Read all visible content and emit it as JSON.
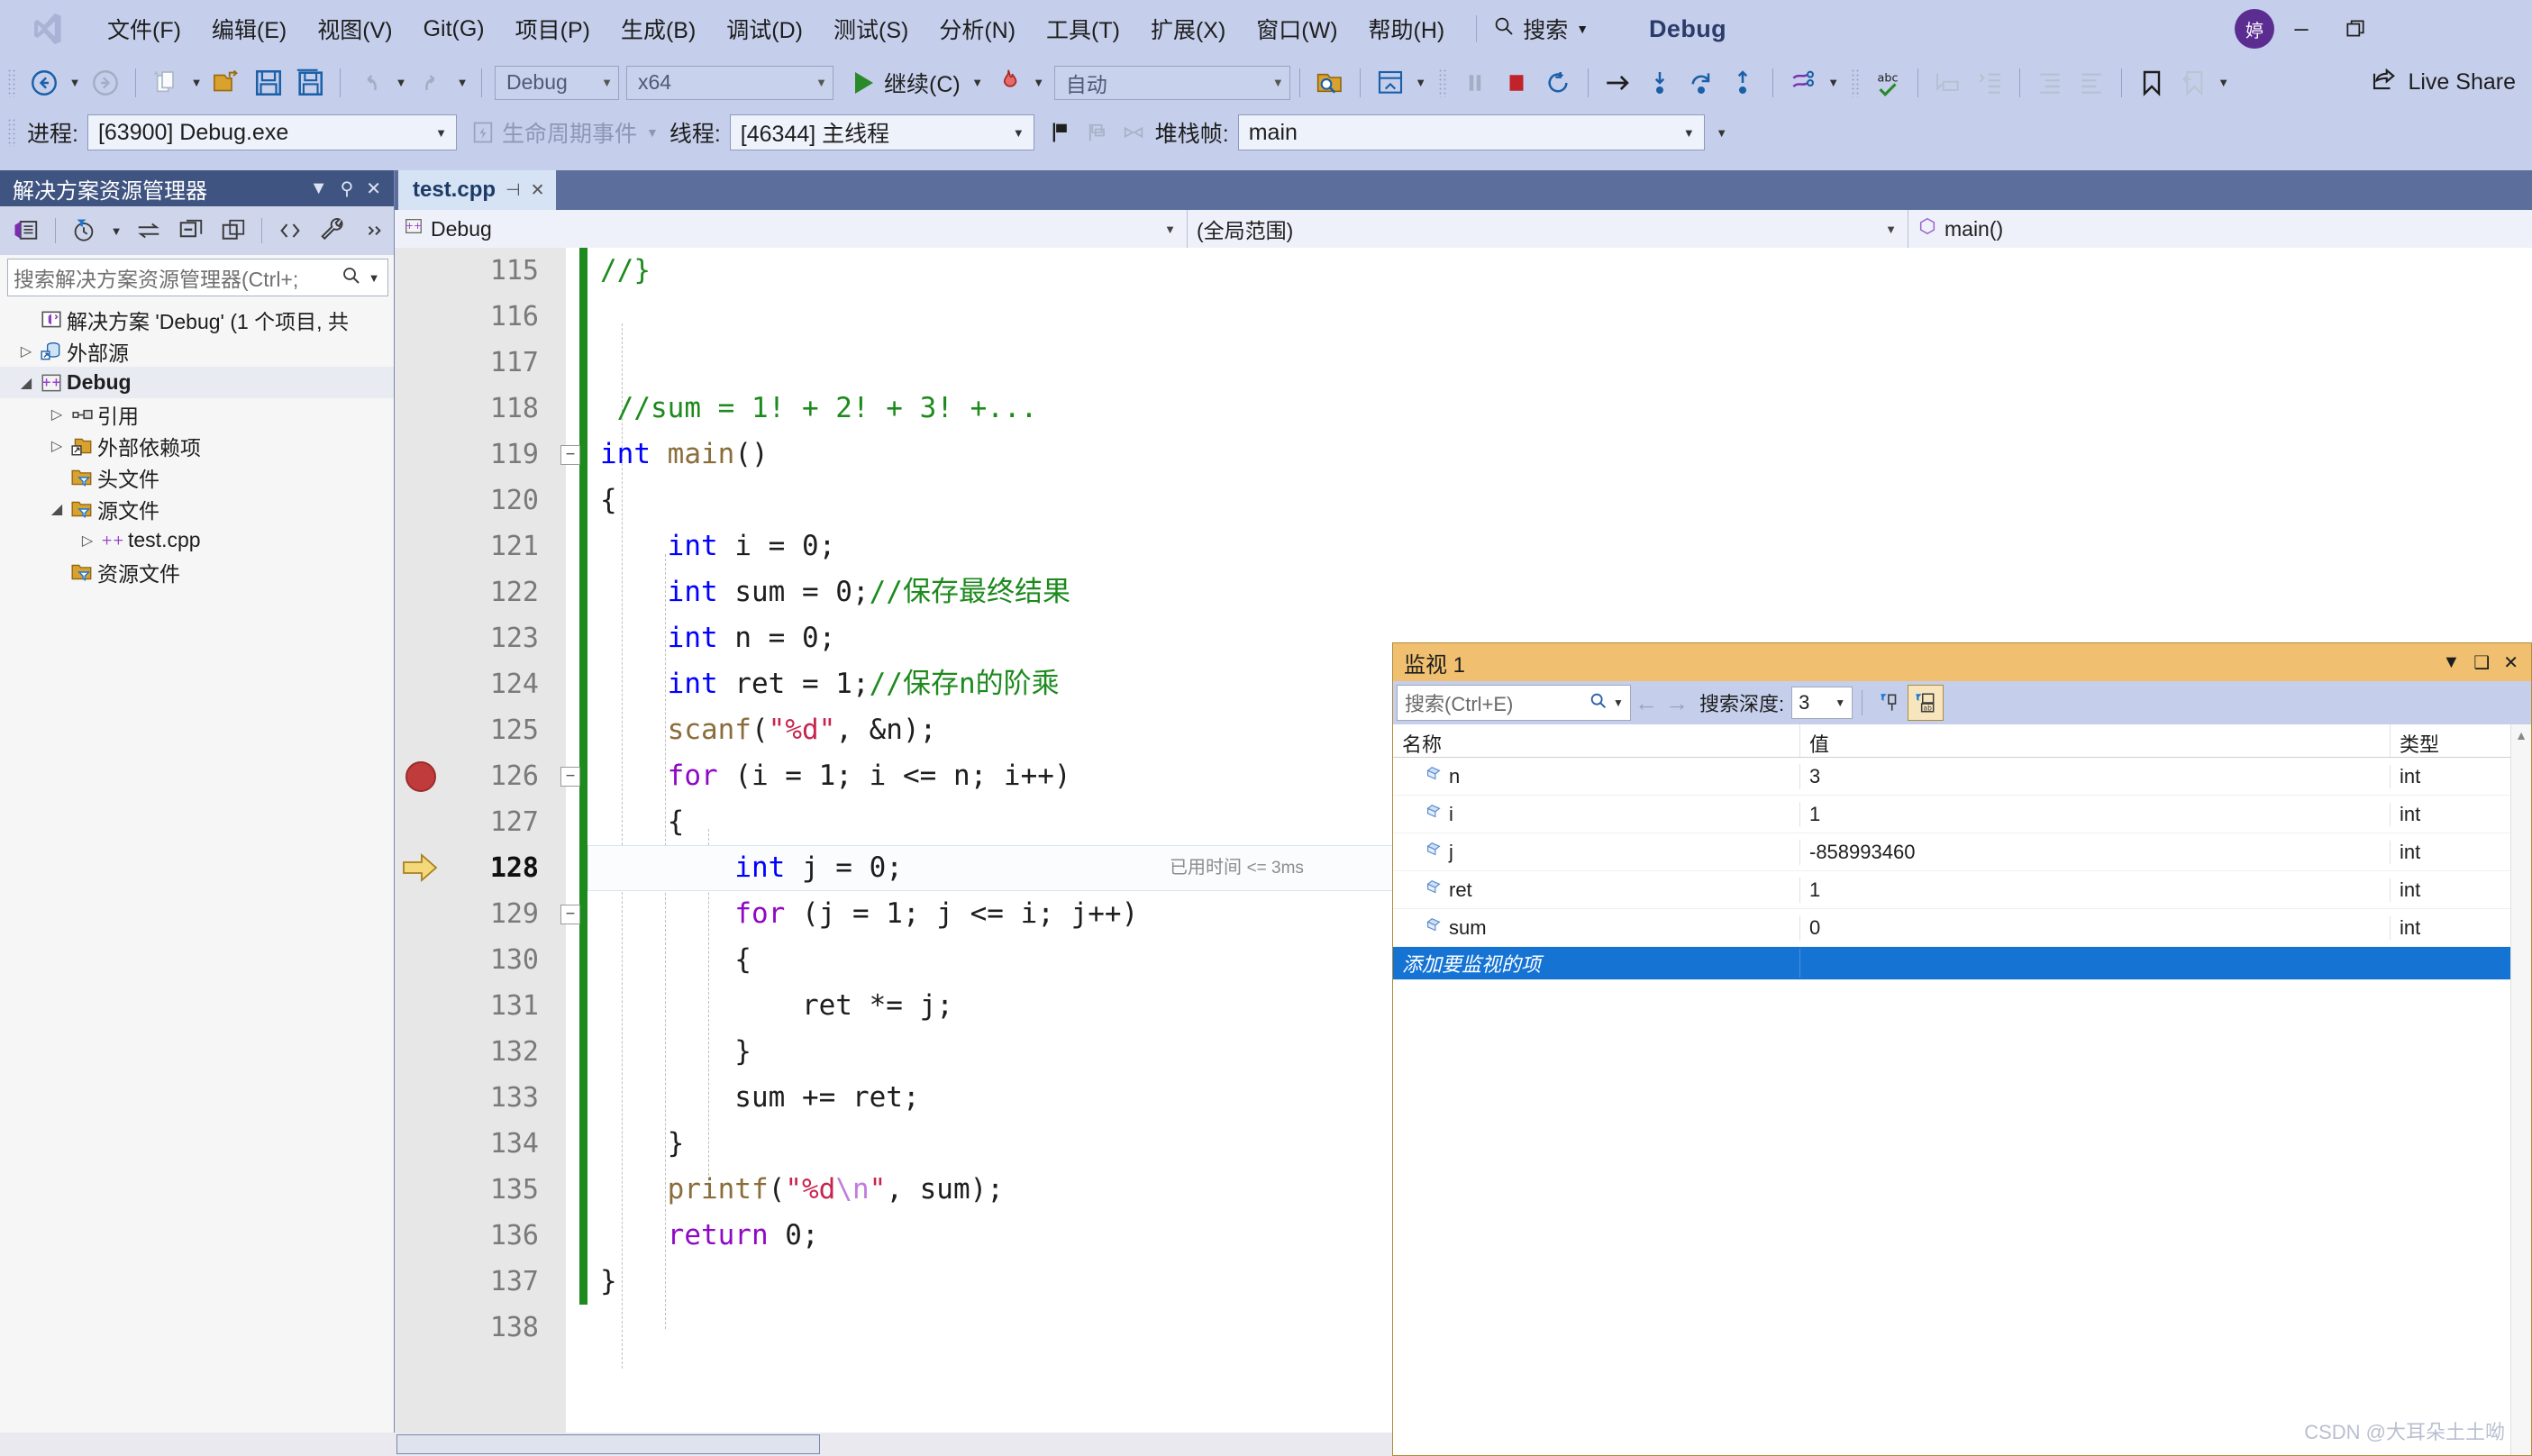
{
  "window": {
    "title": "Debug",
    "avatar_initial": "婷",
    "minimize": "—",
    "restore": "❐"
  },
  "menu": {
    "logo_icon": "visual-studio-logo",
    "items": [
      {
        "label": "文件(F)"
      },
      {
        "label": "编辑(E)"
      },
      {
        "label": "视图(V)"
      },
      {
        "label": "Git(G)"
      },
      {
        "label": "项目(P)"
      },
      {
        "label": "生成(B)"
      },
      {
        "label": "调试(D)"
      },
      {
        "label": "测试(S)"
      },
      {
        "label": "分析(N)"
      },
      {
        "label": "工具(T)"
      },
      {
        "label": "扩展(X)"
      },
      {
        "label": "窗口(W)"
      },
      {
        "label": "帮助(H)"
      }
    ],
    "search_label": "搜索",
    "search_icon": "magnifier-icon"
  },
  "toolbar": {
    "back_icon": "navigate-back-icon",
    "forward_icon": "navigate-forward-icon",
    "new_item_icon": "new-item-icon",
    "open_icon": "open-folder-icon",
    "save_icon": "save-icon",
    "save_all_icon": "save-all-icon",
    "undo_icon": "undo-icon",
    "redo_icon": "redo-icon",
    "config": "Debug",
    "platform": "x64",
    "continue_label": "继续(C)",
    "continue_icon": "play-icon",
    "hot_reload_icon": "hot-reload-flame-icon",
    "process_target": "自动",
    "browse_icon": "browse-folder-icon",
    "window_icon": "preview-window-icon",
    "break_all_icon": "pause-icon",
    "stop_icon": "stop-square-icon",
    "restart_icon": "restart-circular-icon",
    "show_next_icon": "arrow-right-icon",
    "step_into_icon": "step-into-icon",
    "step_over_icon": "step-over-icon",
    "step_out_icon": "step-out-icon",
    "threads_icon": "threads-icon",
    "spell_icon": "abc-check-icon",
    "comment_icon": "comment-icon",
    "uncomment_icon": "uncomment-icon",
    "indent_icon": "indent-icon",
    "outdent_icon": "outdent-icon",
    "bookmark_icon": "bookmark-icon",
    "bookmark_prev_icon": "bookmark-previous-icon",
    "live_share_label": "Live Share",
    "live_share_icon": "share-arrow-icon"
  },
  "debugbar": {
    "process_label": "进程:",
    "process_value": "[63900] Debug.exe",
    "lifecycle_icon": "lifecycle-events-icon",
    "lifecycle_label": "生命周期事件",
    "thread_label": "线程:",
    "thread_value": "[46344] 主线程",
    "flag_icon": "flag-icon",
    "flags_icon": "flags-multiple-icon",
    "link_icon": "link-threads-icon",
    "stackframe_label": "堆栈帧:",
    "stackframe_value": "main"
  },
  "solution_explorer": {
    "title": "解决方案资源管理器",
    "dropdown_icon": "chevron-down-icon",
    "pin_icon": "pin-icon",
    "close_icon": "close-icon",
    "toolbar_icons": [
      "home-solution-icon",
      "pending-changes-filter-icon",
      "sync-views-icon",
      "collapse-all-icon",
      "show-all-files-icon",
      "code-view-icon",
      "properties-wrench-icon",
      "overflow-icon"
    ],
    "search_placeholder": "搜索解决方案资源管理器(Ctrl+;",
    "search_icon": "magnifier-icon",
    "search_dropdown_icon": "chevron-down-icon",
    "tree": [
      {
        "label": "解决方案 'Debug' (1 个项目, 共",
        "icon": "solution-icon",
        "indent": 0,
        "arrow": "",
        "selected": false
      },
      {
        "label": "外部源",
        "icon": "external-sources-icon",
        "indent": 1,
        "arrow": "▷",
        "selected": false
      },
      {
        "label": "Debug",
        "icon": "cpp-project-icon",
        "indent": 1,
        "arrow": "◢",
        "selected": true
      },
      {
        "label": "引用",
        "icon": "references-icon",
        "indent": 2,
        "arrow": "▷",
        "selected": false
      },
      {
        "label": "外部依赖项",
        "icon": "external-deps-icon",
        "indent": 2,
        "arrow": "▷",
        "selected": false
      },
      {
        "label": "头文件",
        "icon": "filter-folder-icon",
        "indent": 2,
        "arrow": "",
        "selected": false
      },
      {
        "label": "源文件",
        "icon": "filter-folder-icon",
        "indent": 2,
        "arrow": "◢",
        "selected": false
      },
      {
        "label": "test.cpp",
        "icon": "cpp-file-icon",
        "indent": 3,
        "arrow": "▷",
        "selected": false
      },
      {
        "label": "资源文件",
        "icon": "filter-folder-icon",
        "indent": 2,
        "arrow": "",
        "selected": false
      }
    ]
  },
  "editor": {
    "tab_label": "test.cpp",
    "tab_pin_icon": "pin-icon",
    "tab_close_icon": "close-icon",
    "project_selector": "Debug",
    "project_icon": "cpp-project-icon",
    "scope_selector": "(全局范围)",
    "member_selector": "main()",
    "member_icon": "method-cube-icon",
    "breakpoint_icon": "breakpoint-icon",
    "current_line_icon": "instruction-pointer-icon",
    "elapsed_label": "已用时间",
    "elapsed_value": "<= 3ms",
    "current_line_number": 128,
    "breakpoint_line_number": 126,
    "first_line_number": 115,
    "lines": [
      {
        "n": 115,
        "code": "//}",
        "kind": "comment"
      },
      {
        "n": 116,
        "code": ""
      },
      {
        "n": 117,
        "code": ""
      },
      {
        "n": 118,
        "code": " //sum = 1! + 2! + 3! +...",
        "kind": "comment"
      },
      {
        "n": 119,
        "code": "int main()"
      },
      {
        "n": 120,
        "code": "{"
      },
      {
        "n": 121,
        "code": "    int i = 0;"
      },
      {
        "n": 122,
        "code": "    int sum = 0;//保存最终结果"
      },
      {
        "n": 123,
        "code": "    int n = 0;"
      },
      {
        "n": 124,
        "code": "    int ret = 1;//保存n的阶乘"
      },
      {
        "n": 125,
        "code": "    scanf(\"%d\", &n);"
      },
      {
        "n": 126,
        "code": "    for (i = 1; i <= n; i++)"
      },
      {
        "n": 127,
        "code": "    {"
      },
      {
        "n": 128,
        "code": "        int j = 0;"
      },
      {
        "n": 129,
        "code": "        for (j = 1; j <= i; j++)"
      },
      {
        "n": 130,
        "code": "        {"
      },
      {
        "n": 131,
        "code": "            ret *= j;"
      },
      {
        "n": 132,
        "code": "        }"
      },
      {
        "n": 133,
        "code": "        sum += ret;"
      },
      {
        "n": 134,
        "code": "    }"
      },
      {
        "n": 135,
        "code": "    printf(\"%d\\n\", sum);"
      },
      {
        "n": 136,
        "code": "    return 0;"
      },
      {
        "n": 137,
        "code": "}"
      },
      {
        "n": 138,
        "code": ""
      }
    ]
  },
  "watch": {
    "title": "监视 1",
    "dropdown_icon": "chevron-down-icon",
    "float_icon": "float-window-icon",
    "close_icon": "close-icon",
    "search_placeholder": "搜索(Ctrl+E)",
    "search_icon": "magnifier-icon",
    "search_dropdown_icon": "chevron-down-icon",
    "prev_icon": "arrow-left-icon",
    "next_icon": "arrow-right-icon",
    "depth_label": "搜索深度:",
    "depth_value": "3",
    "pin_icon": "pin-column-icon",
    "hex_icon": "hexadecimal-display-icon",
    "columns": [
      "名称",
      "值",
      "类型"
    ],
    "rows": [
      {
        "name": "n",
        "value": "3",
        "type": "int",
        "icon": "variable-icon"
      },
      {
        "name": "i",
        "value": "1",
        "type": "int",
        "icon": "variable-icon"
      },
      {
        "name": "j",
        "value": "-858993460",
        "type": "int",
        "icon": "variable-icon"
      },
      {
        "name": "ret",
        "value": "1",
        "type": "int",
        "icon": "variable-icon"
      },
      {
        "name": "sum",
        "value": "0",
        "type": "int",
        "icon": "variable-icon"
      }
    ],
    "add_row_label": "添加要监视的项"
  },
  "watermark": "CSDN @大耳朵土土呦"
}
